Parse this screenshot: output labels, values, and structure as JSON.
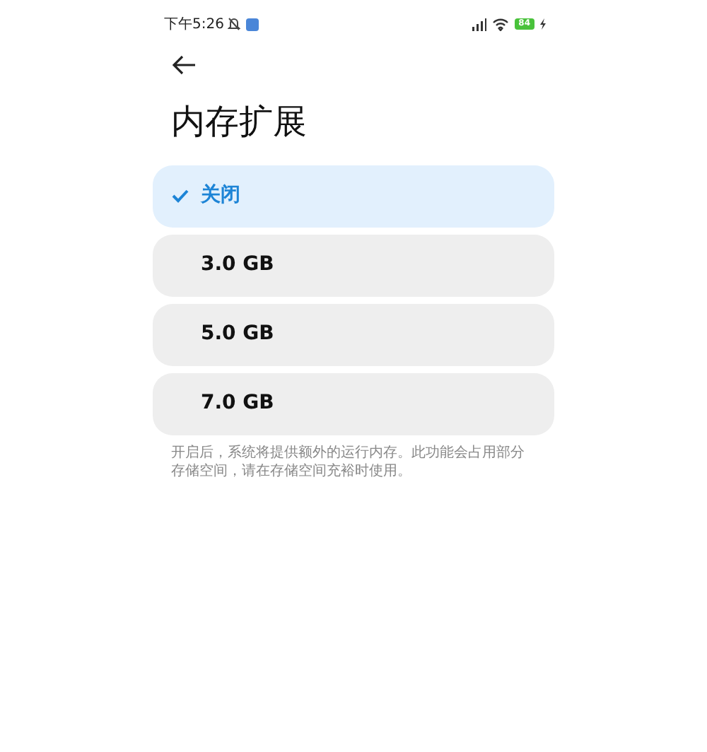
{
  "status_bar": {
    "time": "下午5:26",
    "battery": "84"
  },
  "title": "内存扩展",
  "options": [
    {
      "label": "关闭",
      "selected": true
    },
    {
      "label": "3.0 GB",
      "selected": false
    },
    {
      "label": "5.0 GB",
      "selected": false
    },
    {
      "label": "7.0 GB",
      "selected": false
    }
  ],
  "note": "开启后，系统将提供额外的运行内存。此功能会占用部分存储空间，请在存储空间充裕时使用。"
}
